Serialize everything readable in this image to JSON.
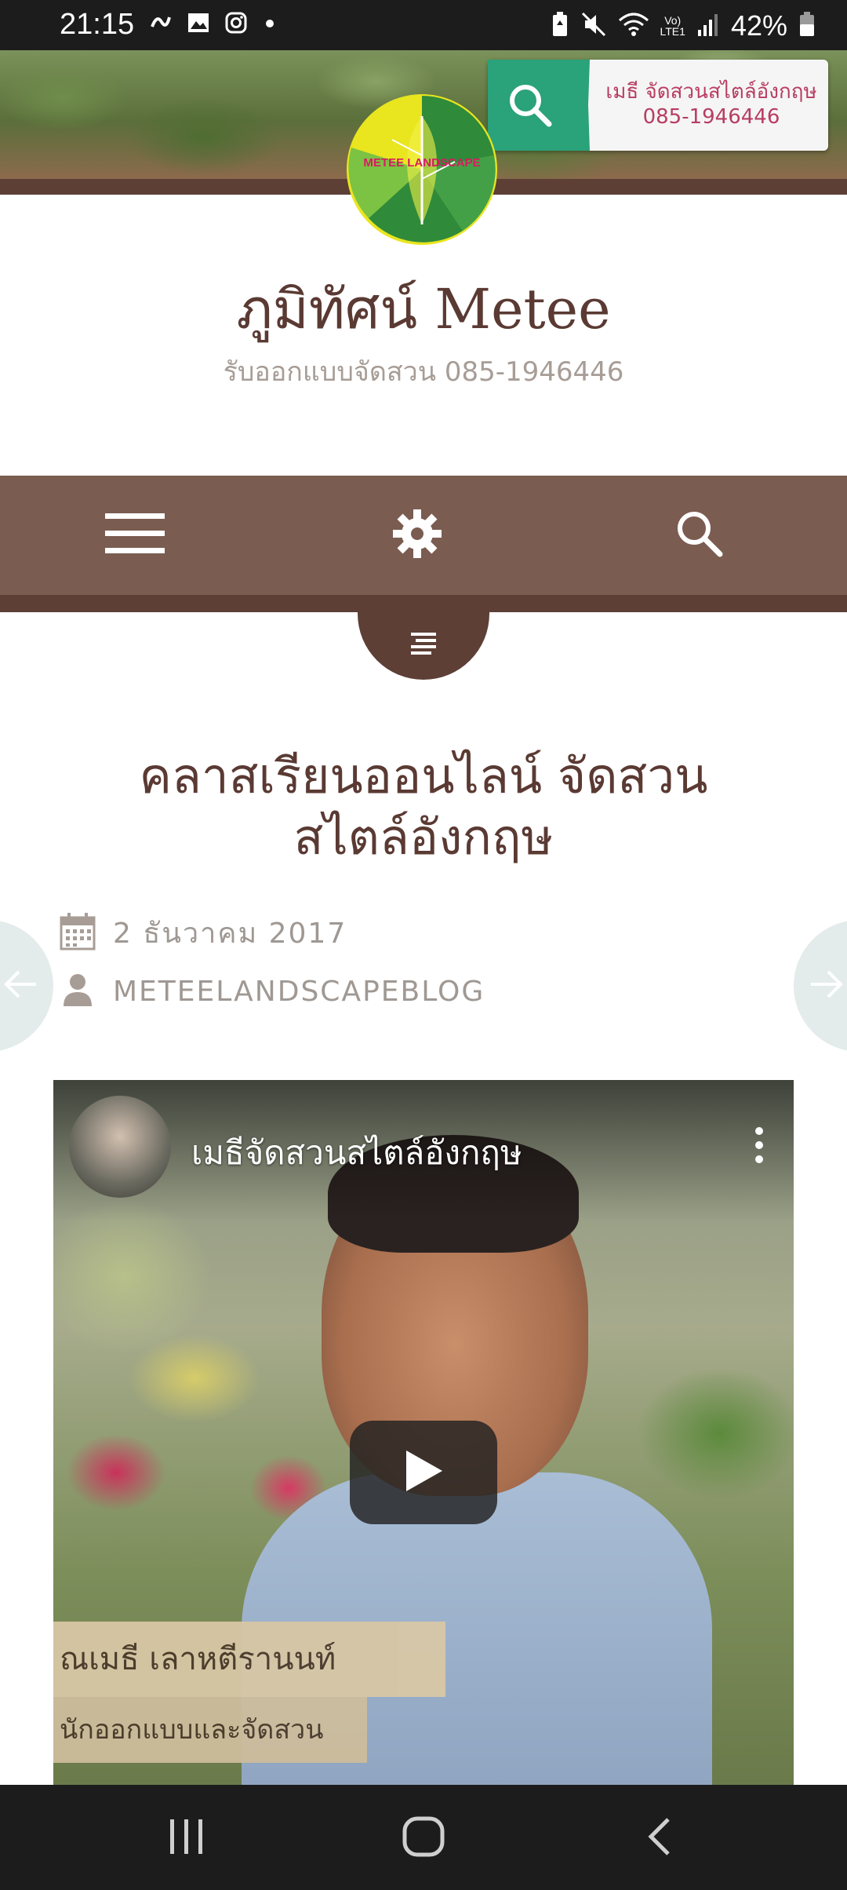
{
  "status_bar": {
    "time": "21:15",
    "battery_text": "42%",
    "icons_left": [
      "notification-icon",
      "gallery-icon",
      "instagram-icon",
      "dot-icon"
    ],
    "icons_right": [
      "battery-saver-icon",
      "mute-icon",
      "wifi-icon",
      "volte-icon",
      "signal-icon",
      "battery-icon"
    ],
    "volte_label": "Vo)",
    "lte_label": "LTE1"
  },
  "header": {
    "ad_line1": "เมธี จัดสวนสไตล์อังกฤษ",
    "ad_line2": "085-1946446",
    "logo_text": "METEE LANDSCAPE"
  },
  "site": {
    "title": "ภูมิทัศน์ Metee",
    "tagline": "รับออกแบบจัดสวน 085-1946446"
  },
  "nav": {
    "items": [
      "menu-icon",
      "gear-icon",
      "search-icon"
    ]
  },
  "post": {
    "title_line1": "คลาสเรียนออนไลน์ จัดสวน",
    "title_line2": "สไตล์อังกฤษ",
    "date": "2 ธันวาคม 2017",
    "author": "METEELANDSCAPEBLOG"
  },
  "video": {
    "channel_name": "เมธีจัดสวนสไตล์อังกฤษ",
    "caption_name": "ณเมธี เลาหตีรานนท์",
    "caption_role": "นักออกแบบและจัดสวน"
  },
  "colors": {
    "brand_brown": "#7b5c51",
    "dark_brown": "#5d3f36",
    "title_color": "#5a3a33",
    "meta_gray": "#9f9893"
  }
}
